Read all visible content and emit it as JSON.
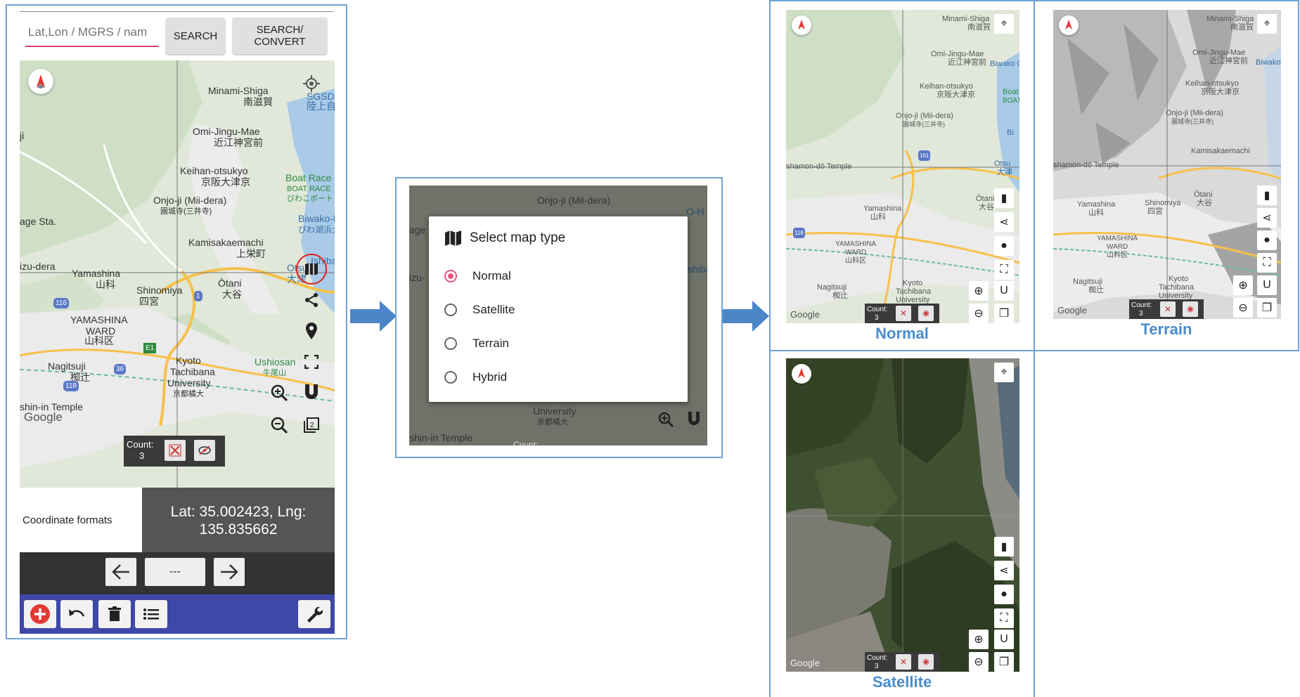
{
  "phone": {
    "search_placeholder": "Lat,Lon / MGRS / nam",
    "search_button": "SEARCH",
    "search_convert_button": "SEARCH/\nCONVERT",
    "map_labels": {
      "minami_shiga": "Minami-Shiga",
      "minami_shiga_jp": "南滋賀",
      "omi_jingu": "Omi-Jingu-Mae",
      "omi_jingu_jp": "近江神宮前",
      "keihan_otsukyo": "Keihan-otsukyo",
      "keihan_otsukyo_jp": "京阪大津京",
      "boat_race": "Boat Race",
      "boat_race_jp": "BOAT RACE",
      "boat_race_jp2": "びわこボート",
      "onjoji": "Onjo-ji (Mii-dera)",
      "onjoji_jp": "園城寺(三井寺)",
      "biwako": "Biwako-H",
      "biwako_jp": "びわ湖浜大",
      "kamisakae": "Kamisakaemachi",
      "kamisakae_jp": "上栄町",
      "ishiba": "Ishiba",
      "otsu": "Otsu",
      "otsu_jp": "大津",
      "age_sta": "age Sta.",
      "izu_dera": "izu-dera",
      "yamashina": "Yamashina",
      "yamashina_jp": "山科",
      "shinomiya": "Shinomiya",
      "shinomiya_jp": "四宮",
      "otani": "Ōtani",
      "otani_jp": "大谷",
      "yamashina_ward": "YAMASHINA",
      "ward": "WARD",
      "yamashina_ku": "山科区",
      "nagitsuji": "Nagitsuji",
      "nagitsuji_jp": "椥辻",
      "kyoto_tachibana": "Kyoto",
      "tachibana": "Tachibana",
      "university": "University",
      "tachibana_jp": "京都橘大",
      "ushiosan": "Ushiosan",
      "ushiosan_jp": "牛尾山",
      "shin_in": "shin-in Temple",
      "google": "Google",
      "ji": "ji",
      "sgsd": "SGSDI",
      "rikujo": "陸上自"
    },
    "count_label": "Count:",
    "count_value": "3",
    "coordinate_formats": "Coordinate formats",
    "lat_lng": "Lat: 35.002423, Lng: 135.835662",
    "nav_middle": "---",
    "road_118": "118",
    "road_116": "116",
    "road_36": "36",
    "road_e1": "E1",
    "road_1": "1",
    "toolbar_color": "#3f48a8"
  },
  "dialog": {
    "title": "Select map type",
    "options": [
      "Normal",
      "Satellite",
      "Terrain",
      "Hybrid"
    ],
    "selected": "Normal",
    "bg_labels": {
      "onjoji": "Onjo-ji (Mii-dera)",
      "age": "age",
      "izu": "izu-",
      "shiba": "shiba",
      "university": "University",
      "university_jp": "京都橘大",
      "shin_in": "shin-in Temple",
      "count": "Count:",
      "otsu_h": "O-H"
    }
  },
  "captions": {
    "normal": "Normal",
    "terrain": "Terrain",
    "satellite": "Satellite"
  },
  "mini_map": {
    "minami_shiga": "Minami-Shiga",
    "minami_shiga_jp": "南滋賀",
    "omi_jingu": "Omi-Jingu-Mae",
    "omi_jingu_jp": "近江神宮前",
    "biwako": "Biwako O",
    "keihan": "Keihan-otsukyo",
    "keihan_jp": "京阪大津京",
    "onjoji": "Onjo-ji (Mii-dera)",
    "onjoji_jp": "園城寺(三井寺)",
    "kamisakae": "Kamisakaemachi",
    "shamon": "shamon-dō Temple",
    "yamashina": "Yamashina",
    "yamashina_jp": "山科",
    "shinomiya": "Shinomiya",
    "shinomiya_jp": "四宮",
    "yamashina_ward": "YAMASHINA",
    "ward": "WARD",
    "ku": "山科区",
    "nagitsuji": "Nagitsuji",
    "nagitsuji_jp": "椥辻",
    "kyoto": "Kyoto",
    "tachibana": "Tachibana",
    "university": "University",
    "otani": "Ōtani",
    "otani_jp": "大谷",
    "otsu": "Otsu",
    "otsu_jp": "大津",
    "boat": "Boat",
    "boat2": "BOAT",
    "bi": "Bi",
    "google": "Google",
    "count": "Count:",
    "count_value": "3",
    "road_161": "161",
    "road_118": "118"
  },
  "colors": {
    "frame_border": "#6fa3d6",
    "arrow": "#4a86c8",
    "caption": "#4a8ccc",
    "radio_selected": "#e8557a",
    "search_underline": "#d9436b",
    "add_button": "#e53935"
  }
}
